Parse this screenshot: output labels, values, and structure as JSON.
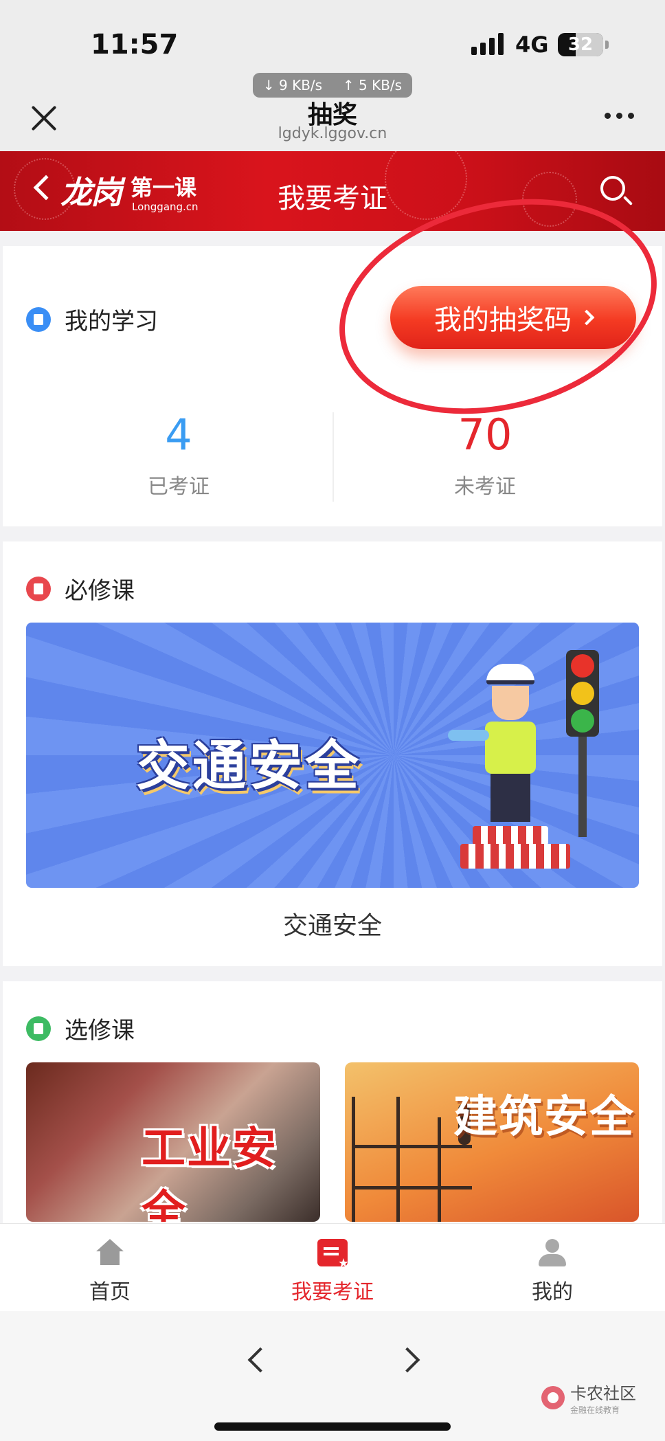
{
  "status_bar": {
    "time": "11:57",
    "network": "4G",
    "battery": "32",
    "download_speed": "↓ 9 KB/s",
    "upload_speed": "↑ 5 KB/s"
  },
  "nav_bar": {
    "title": "抽奖",
    "url": "lgdyk.lggov.cn"
  },
  "header": {
    "logo_calligraphy": "龙岗",
    "logo_sub": "第一课",
    "logo_domain": "Longgang.cn",
    "title": "我要考证"
  },
  "my_study": {
    "title": "我的学习",
    "lottery_button": "我的抽奖码",
    "stats": [
      {
        "value": "4",
        "label": "已考证",
        "color": "#3a9cf2"
      },
      {
        "value": "70",
        "label": "未考证",
        "color": "#e4262c"
      }
    ]
  },
  "required": {
    "title": "必修课",
    "banner_title": "交通安全",
    "caption": "交通安全"
  },
  "elective": {
    "title": "选修课",
    "items": [
      {
        "label": "工业安全"
      },
      {
        "label": "建筑安全"
      }
    ]
  },
  "tab_bar": {
    "items": [
      {
        "label": "首页",
        "icon": "home-icon"
      },
      {
        "label": "我要考证",
        "icon": "certificate-icon"
      },
      {
        "label": "我的",
        "icon": "user-icon"
      }
    ],
    "active": "我要考证"
  },
  "watermark": {
    "name": "卡农社区",
    "tagline": "金融在线教育"
  },
  "colors": {
    "brand_red": "#e4262c",
    "stat_blue": "#3a9cf2",
    "annotation_circle": "#ec2a3a"
  }
}
